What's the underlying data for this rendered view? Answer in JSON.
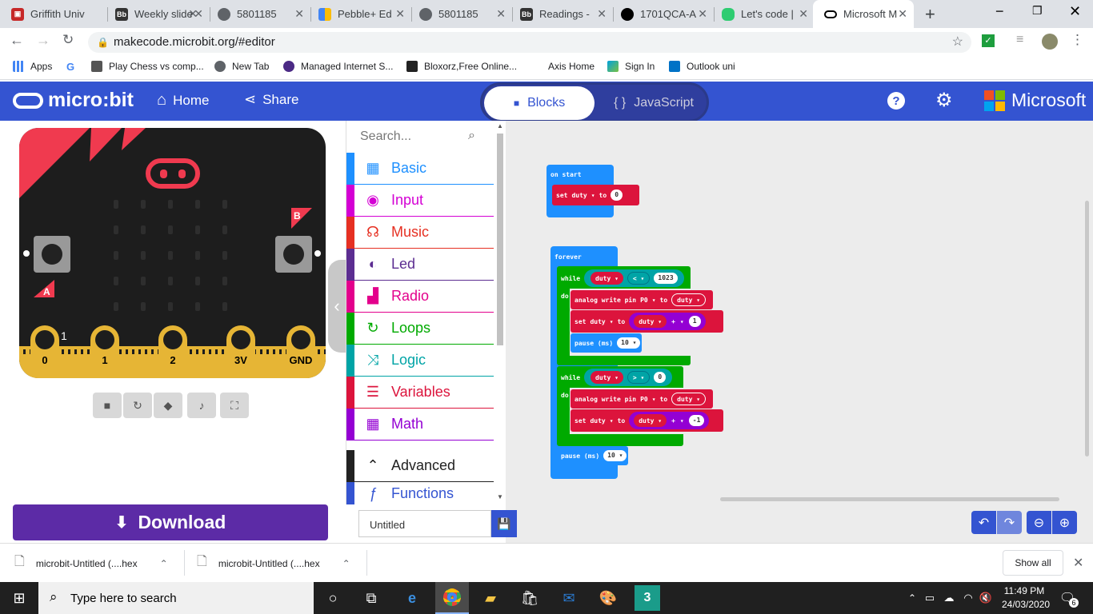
{
  "browser": {
    "tabs": [
      {
        "title": "Griffith Univ",
        "icon": "griffith-icon",
        "color": "#c62828"
      },
      {
        "title": "Weekly slide",
        "icon": "blackboard-icon",
        "color": "#333333"
      },
      {
        "title": "5801185",
        "icon": "globe-icon",
        "color": "#5f6368"
      },
      {
        "title": "Pebble+ Ed",
        "icon": "pebble-icon",
        "color": "#34a853"
      },
      {
        "title": "5801185",
        "icon": "globe-icon",
        "color": "#5f6368"
      },
      {
        "title": "Readings -",
        "icon": "blackboard-icon",
        "color": "#333333"
      },
      {
        "title": "1701QCA-A",
        "icon": "github-icon",
        "color": "#000000"
      },
      {
        "title": "Let's code |",
        "icon": "code-icon",
        "color": "#2ecc71"
      },
      {
        "title": "Microsoft M",
        "icon": "microbit-icon",
        "color": "#000000",
        "active": true
      }
    ],
    "url": "makecode.microbit.org/#editor",
    "bookmarks": [
      "Apps",
      "Play Chess vs comp...",
      "New Tab",
      "Managed Internet S...",
      "Bloxorz,Free Online...",
      "Axis Home",
      "Sign In",
      "Outlook uni"
    ]
  },
  "makecode": {
    "logo": "micro:bit",
    "home": "Home",
    "share": "Share",
    "blocks": "Blocks",
    "javascript": "JavaScript",
    "brand": "Microsoft",
    "accent": "#3454d1"
  },
  "simulator": {
    "pins": [
      "0",
      "1",
      "2",
      "3V",
      "GND"
    ],
    "pin_value": "1",
    "button_a": "A",
    "button_b": "B",
    "download": "Download"
  },
  "toolbox": {
    "search_placeholder": "Search...",
    "categories": [
      {
        "label": "Basic",
        "color": "#1e90ff",
        "icon": "grid-icon"
      },
      {
        "label": "Input",
        "color": "#d400d4",
        "icon": "target-icon"
      },
      {
        "label": "Music",
        "color": "#e63022",
        "icon": "headphones-icon"
      },
      {
        "label": "Led",
        "color": "#5c2d91",
        "icon": "toggle-icon"
      },
      {
        "label": "Radio",
        "color": "#e3008c",
        "icon": "signal-icon"
      },
      {
        "label": "Loops",
        "color": "#00aa00",
        "icon": "refresh-icon"
      },
      {
        "label": "Logic",
        "color": "#00a4a6",
        "icon": "shuffle-icon"
      },
      {
        "label": "Variables",
        "color": "#dc143c",
        "icon": "list-icon"
      },
      {
        "label": "Math",
        "color": "#9400d3",
        "icon": "calculator-icon"
      }
    ],
    "advanced": "Advanced",
    "functions": "Functions"
  },
  "workspace": {
    "on_start": "on start",
    "set": "set",
    "to": "to",
    "var": "duty",
    "zero": "0",
    "forever": "forever",
    "while": "while",
    "do": "do",
    "lt": "<",
    "gt": ">",
    "v1023": "1023",
    "analog": "analog write pin",
    "pin": "P0",
    "plus": "+",
    "one": "1",
    "minus_one": "-1",
    "pause": "pause (ms)",
    "ten": "10"
  },
  "footer": {
    "project_name": "Untitled"
  },
  "downloads": [
    {
      "name": "microbit-Untitled (....hex"
    },
    {
      "name": "microbit-Untitled (....hex"
    }
  ],
  "show_all": "Show all",
  "taskbar": {
    "search": "Type here to search",
    "time": "11:49 PM",
    "date": "24/03/2020",
    "notifications": "6"
  }
}
